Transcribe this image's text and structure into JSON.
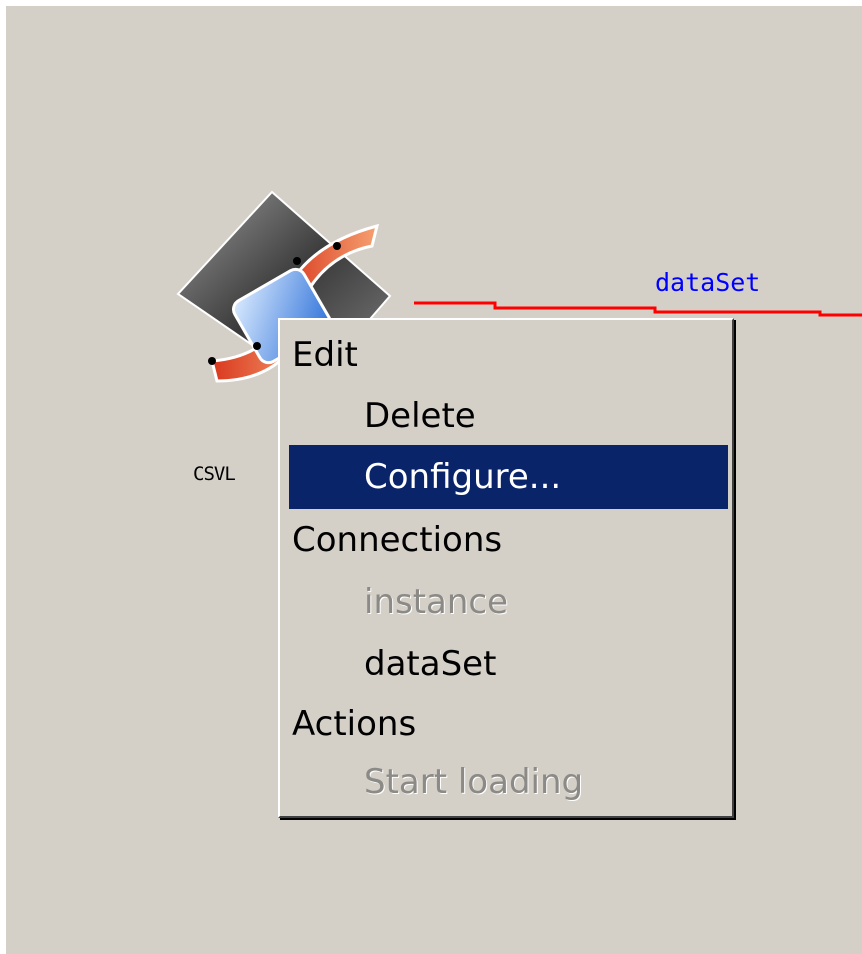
{
  "component": {
    "label": "CSVL",
    "icon": "csv-loader-icon"
  },
  "connection": {
    "label": "dataSet",
    "color": "#ff0000",
    "label_color": "#0000ff"
  },
  "context_menu": {
    "selected_color": "#0a246a",
    "sections": [
      {
        "header": "Edit",
        "items": [
          {
            "label": "Delete",
            "enabled": true,
            "selected": false
          },
          {
            "label": "Configure...",
            "enabled": true,
            "selected": true
          }
        ]
      },
      {
        "header": "Connections",
        "items": [
          {
            "label": "instance",
            "enabled": false,
            "selected": false
          },
          {
            "label": "dataSet",
            "enabled": true,
            "selected": false
          }
        ]
      },
      {
        "header": "Actions",
        "items": [
          {
            "label": "Start loading",
            "enabled": false,
            "selected": false
          }
        ]
      }
    ]
  }
}
